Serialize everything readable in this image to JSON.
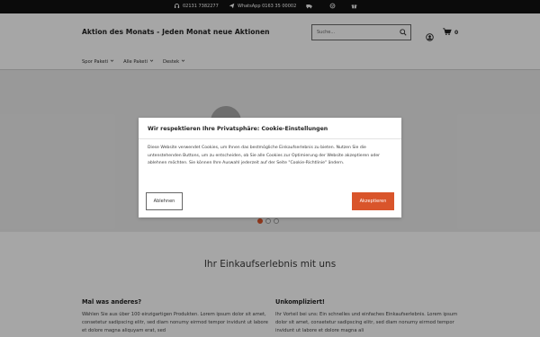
{
  "topbar": {
    "phone": "02131 7382277",
    "whatsapp": "WhatsApp 0163 35 00002"
  },
  "header": {
    "shop_title": "Aktion des Monats - Jeden Monat neue Aktionen",
    "search_placeholder": "Suche...",
    "cart_count": "0"
  },
  "nav": {
    "items": [
      {
        "label": "Spor Paketi"
      },
      {
        "label": "Alle Paketi"
      },
      {
        "label": "Destek"
      }
    ]
  },
  "hero": {
    "slides": 3,
    "active_slide": 1
  },
  "content": {
    "section_title": "Ihr Einkaufserlebnis mit uns",
    "columns": [
      {
        "heading": "Mal was anderes?",
        "text": "Wählen Sie aus über 100 einzigartigen Produkten. Lorem ipsum dolor sit amet, consetetur sadipscing elitr, sed diam nonumy eirmod tempor invidunt ut labore et dolore magna aliquyam erat, sed"
      },
      {
        "heading": "Unkompliziert!",
        "text": "Ihr Vorteil bei uns: Ein schnelles und einfaches Einkaufserlebnis. Lorem ipsum dolor sit amet, consetetur sadipscing elitr, sed diam nonumy eirmod tempor invidunt ut labore et dolore magna ali"
      }
    ]
  },
  "cookie": {
    "title": "Wir respektieren Ihre Privatsphäre: Cookie-Einstellungen",
    "text": "Diese Website verwendet Cookies, um Ihnen das bestmögliche Einkaufserlebnis zu bieten. Nutzen Sie die untenstehenden Buttons, um zu entscheiden, ob Sie alle Cookies zur Optimierung der Website akzeptieren oder ablehnen möchten. Sie können Ihre Auswahl jederzeit auf der Seite \"Cookie-Richtlinie\" ändern.",
    "decline_label": "Ablehnen",
    "accept_label": "Akzeptieren"
  },
  "colors": {
    "accent": "#d9552b",
    "topbar": "#111111"
  }
}
